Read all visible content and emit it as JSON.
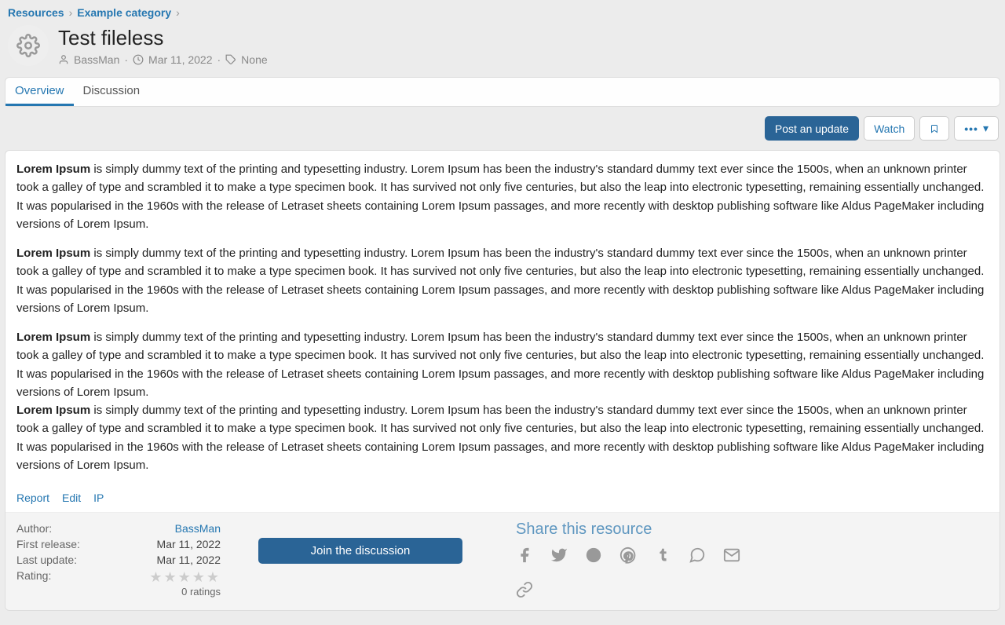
{
  "breadcrumb": {
    "items": [
      "Resources",
      "Example category"
    ]
  },
  "header": {
    "title": "Test fileless",
    "author": "BassMan",
    "date": "Mar 11, 2022",
    "tags": "None"
  },
  "tabs": [
    "Overview",
    "Discussion"
  ],
  "actions": {
    "post_update": "Post an update",
    "watch": "Watch"
  },
  "content": {
    "lead": "Lorem Ipsum",
    "para": " is simply dummy text of the printing and typesetting industry. Lorem Ipsum has been the industry's standard dummy text ever since the 1500s, when an unknown printer took a galley of type and scrambled it to make a type specimen book. It has survived not only five centuries, but also the leap into electronic typesetting, remaining essentially unchanged. It was popularised in the 1960s with the release of Letraset sheets containing Lorem Ipsum passages, and more recently with desktop publishing software like Aldus PageMaker including versions of Lorem Ipsum."
  },
  "post_links": {
    "report": "Report",
    "edit": "Edit",
    "ip": "IP"
  },
  "info": {
    "author_label": "Author:",
    "author_value": "BassMan",
    "first_release_label": "First release:",
    "first_release_value": "Mar 11, 2022",
    "last_update_label": "Last update:",
    "last_update_value": "Mar 11, 2022",
    "rating_label": "Rating:",
    "ratings_count": "0 ratings"
  },
  "join_button": "Join the discussion",
  "share": {
    "title": "Share this resource"
  }
}
